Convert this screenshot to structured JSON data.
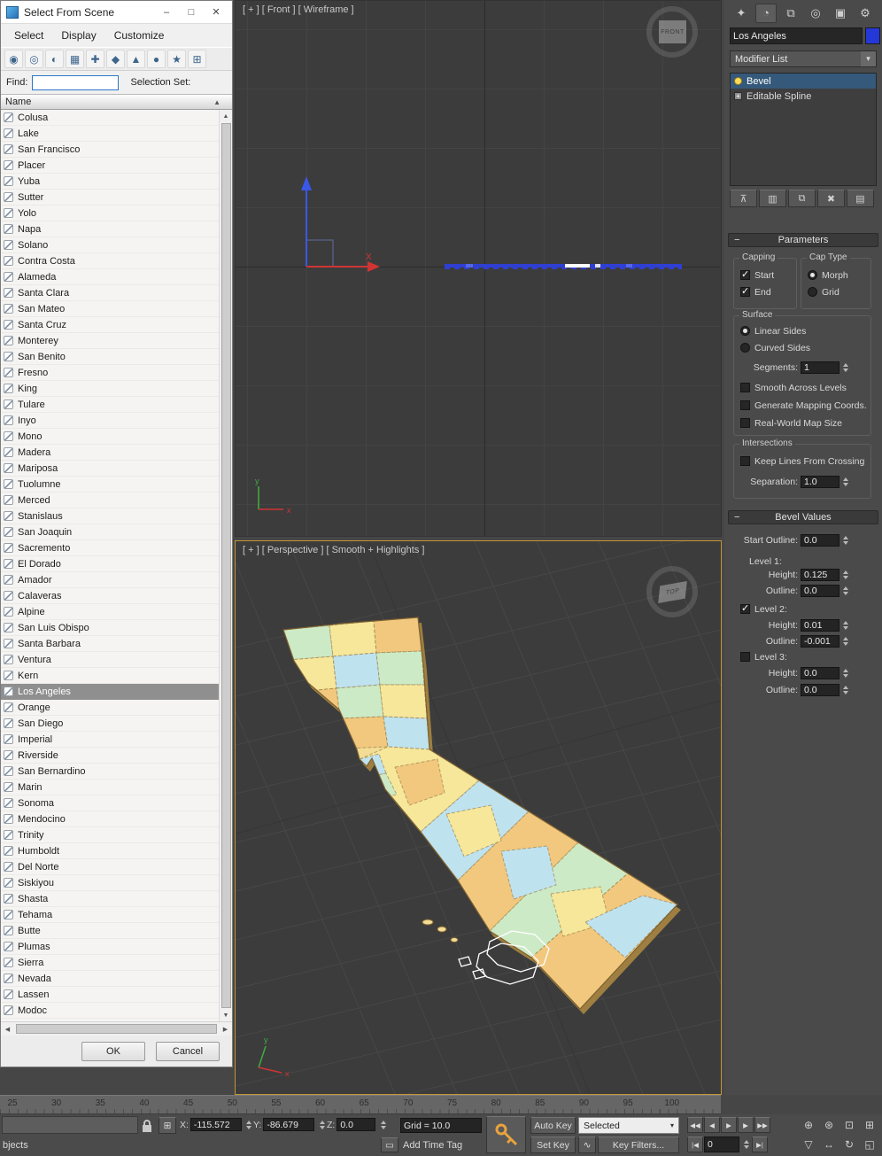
{
  "ui": {
    "collapse": "−",
    "sort_asc": "▲",
    "scroll_up": "▲",
    "scroll_down": "▼",
    "scroll_left": "◀",
    "scroll_right": "▶",
    "dropdown_arrow": "▾",
    "snap_glyph": "⊞",
    "wave_glyph": "∿",
    "go_start_glyph": "|◀",
    "go_end_glyph": "▶|",
    "time_tag_glyph": "▭"
  },
  "dialog": {
    "title": "Select From Scene",
    "window_buttons": [
      {
        "name": "minimize-button",
        "glyph": "–"
      },
      {
        "name": "maximize-button",
        "glyph": "□"
      },
      {
        "name": "close-button",
        "glyph": "✕"
      }
    ],
    "menus": [
      "Select",
      "Display",
      "Customize"
    ],
    "toolbar_icons": [
      {
        "name": "select-all-icon",
        "glyph": "◉"
      },
      {
        "name": "select-none-icon",
        "glyph": "◎"
      },
      {
        "name": "select-invert-icon",
        "glyph": "◐"
      },
      {
        "name": "display-geometry-icon",
        "glyph": "▦"
      },
      {
        "name": "display-shapes-icon",
        "glyph": "✚"
      },
      {
        "name": "display-lights-icon",
        "glyph": "◆"
      },
      {
        "name": "display-cameras-icon",
        "glyph": "▲"
      },
      {
        "name": "display-helpers-icon",
        "glyph": "●"
      },
      {
        "name": "display-spacewarps-icon",
        "glyph": "★"
      },
      {
        "name": "display-groups-icon",
        "glyph": "⊞"
      }
    ],
    "find_label": "Find:",
    "selection_set_label": "Selection Set:",
    "column_header": "Name",
    "items": [
      "Colusa",
      "Lake",
      "San Francisco",
      "Placer",
      "Yuba",
      "Sutter",
      "Yolo",
      "Napa",
      "Solano",
      "Contra Costa",
      "Alameda",
      "Santa Clara",
      "San Mateo",
      "Santa Cruz",
      "Monterey",
      "San Benito",
      "Fresno",
      "King",
      "Tulare",
      "Inyo",
      "Mono",
      "Madera",
      "Mariposa",
      "Tuolumne",
      "Merced",
      "Stanislaus",
      "San Joaquin",
      "Sacremento",
      "El Dorado",
      "Amador",
      "Calaveras",
      "Alpine",
      "San Luis Obispo",
      "Santa Barbara",
      "Ventura",
      "Kern",
      "Los Angeles",
      "Orange",
      "San Diego",
      "Imperial",
      "Riverside",
      "San Bernardino",
      "Marin",
      "Sonoma",
      "Mendocino",
      "Trinity",
      "Humboldt",
      "Del Norte",
      "Siskiyou",
      "Shasta",
      "Tehama",
      "Butte",
      "Plumas",
      "Sierra",
      "Nevada",
      "Lassen",
      "Modoc"
    ],
    "selected_item": "Los Angeles",
    "ok_label": "OK",
    "cancel_label": "Cancel"
  },
  "viewports": {
    "front": {
      "label": "[ + ] [ Front ] [ Wireframe ]",
      "cube_label": "FRONT",
      "axis_x_label": "X",
      "tripod_x": "x",
      "tripod_y": "y"
    },
    "perspective": {
      "label": "[ + ] [ Perspective ] [ Smooth + Highlights ]",
      "cube_label": "TOP",
      "tripod_x": "x",
      "tripod_y": "y"
    }
  },
  "command_panel": {
    "tabs": [
      {
        "name": "create-tab",
        "glyph": "✦"
      },
      {
        "name": "modify-tab",
        "glyph": "◔"
      },
      {
        "name": "hierarchy-tab",
        "glyph": "⧉"
      },
      {
        "name": "motion-tab",
        "glyph": "◎"
      },
      {
        "name": "display-tab",
        "glyph": "▣"
      },
      {
        "name": "utilities-tab",
        "glyph": "⚙"
      }
    ],
    "object_name": "Los Angeles",
    "object_color": "#2438d8",
    "modifier_list_label": "Modifier List",
    "stack": [
      {
        "label": "Bevel",
        "selected": true
      },
      {
        "label": "Editable Spline",
        "selected": false
      }
    ],
    "stack_tools": [
      {
        "name": "pin-stack-icon",
        "glyph": "⊼"
      },
      {
        "name": "show-end-result-icon",
        "glyph": "▥"
      },
      {
        "name": "make-unique-icon",
        "glyph": "⧉"
      },
      {
        "name": "remove-modifier-icon",
        "glyph": "✖"
      },
      {
        "name": "configure-modifier-sets-icon",
        "glyph": "▤"
      }
    ],
    "parameters": {
      "title": "Parameters",
      "capping_title": "Capping",
      "start_label": "Start",
      "start_checked": true,
      "end_label": "End",
      "end_checked": true,
      "cap_type_title": "Cap Type",
      "morph_label": "Morph",
      "morph_selected": true,
      "grid_label": "Grid",
      "grid_selected": false,
      "surface_title": "Surface",
      "linear_label": "Linear Sides",
      "linear_selected": true,
      "curved_label": "Curved Sides",
      "curved_selected": false,
      "segments_label": "Segments:",
      "segments_value": "1",
      "smooth_label": "Smooth Across Levels",
      "smooth_checked": false,
      "mapping_label": "Generate Mapping Coords.",
      "mapping_checked": false,
      "realworld_label": "Real-World Map Size",
      "realworld_checked": false,
      "intersections_title": "Intersections",
      "keep_lines_label": "Keep Lines From Crossing",
      "keep_lines_checked": false,
      "separation_label": "Separation:",
      "separation_value": "1.0"
    },
    "bevel_values": {
      "title": "Bevel Values",
      "start_outline_label": "Start Outline:",
      "start_outline_value": "0.0",
      "height_label": "Height:",
      "outline_label": "Outline:",
      "level1_label": "Level 1:",
      "level1_height": "0.125",
      "level1_outline": "0.0",
      "level2_label": "Level 2:",
      "level2_checked": true,
      "level2_height": "0.01",
      "level2_outline": "-0.001",
      "level3_label": "Level 3:",
      "level3_checked": false,
      "level3_height": "0.0",
      "level3_outline": "0.0"
    }
  },
  "timeline": {
    "ticks": [
      "25",
      "30",
      "35",
      "40",
      "45",
      "50",
      "55",
      "60",
      "65",
      "70",
      "75",
      "80",
      "85",
      "90",
      "95",
      "100"
    ]
  },
  "status_bar": {
    "prompt": "bjects",
    "x_label": "X:",
    "x_value": "-115.572",
    "y_label": "Y:",
    "y_value": "-86.679",
    "z_label": "Z:",
    "z_value": "0.0",
    "grid_value": "Grid = 10.0",
    "auto_key_label": "Auto Key",
    "set_key_label": "Set Key",
    "selected_value": "Selected",
    "key_filters_label": "Key Filters...",
    "add_time_tag_label": "Add Time Tag",
    "frame_value": "0",
    "playback_row1": [
      {
        "name": "previous-key-button",
        "glyph": "◀◀"
      },
      {
        "name": "previous-frame-button",
        "glyph": "◀"
      },
      {
        "name": "play-button",
        "glyph": "▶"
      },
      {
        "name": "next-frame-button",
        "glyph": "▶"
      },
      {
        "name": "next-key-button",
        "glyph": "▶▶"
      }
    ],
    "nav_icons_row1": [
      {
        "name": "zoom-icon",
        "glyph": "⊕"
      },
      {
        "name": "zoom-all-icon",
        "glyph": "⊛"
      },
      {
        "name": "zoom-extents-icon",
        "glyph": "⊡"
      },
      {
        "name": "zoom-extents-all-icon",
        "glyph": "⊞"
      }
    ],
    "nav_icons_row2": [
      {
        "name": "field-of-view-icon",
        "glyph": "▽"
      },
      {
        "name": "pan-icon",
        "glyph": "↔"
      },
      {
        "name": "orbit-icon",
        "glyph": "↻"
      },
      {
        "name": "maximize-viewport-icon",
        "glyph": "◱"
      }
    ]
  }
}
